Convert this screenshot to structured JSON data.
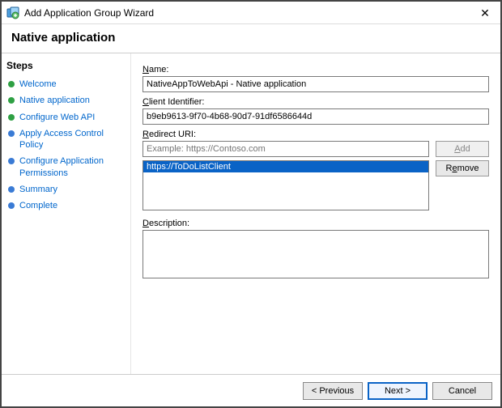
{
  "window": {
    "title": "Add Application Group Wizard",
    "close_label": "✕"
  },
  "heading": "Native application",
  "sidebar": {
    "title": "Steps",
    "items": [
      {
        "label": "Welcome",
        "state": "done"
      },
      {
        "label": "Native application",
        "state": "done"
      },
      {
        "label": "Configure Web API",
        "state": "done"
      },
      {
        "label": "Apply Access Control Policy",
        "state": "pending"
      },
      {
        "label": "Configure Application Permissions",
        "state": "pending"
      },
      {
        "label": "Summary",
        "state": "pending"
      },
      {
        "label": "Complete",
        "state": "pending"
      }
    ]
  },
  "form": {
    "name_label_pre": "",
    "name_label_u": "N",
    "name_label_post": "ame:",
    "name_value": "NativeAppToWebApi - Native application",
    "client_id_label_pre": "",
    "client_id_label_u": "C",
    "client_id_label_post": "lient Identifier:",
    "client_id_value": "b9eb9613-9f70-4b68-90d7-91df6586644d",
    "redirect_label_pre": "",
    "redirect_label_u": "R",
    "redirect_label_post": "edirect URI:",
    "redirect_placeholder": "Example: https://Contoso.com",
    "redirect_value": "",
    "add_btn_pre": "",
    "add_btn_u": "A",
    "add_btn_post": "dd",
    "remove_btn_pre": "R",
    "remove_btn_u": "e",
    "remove_btn_post": "move",
    "uri_list": [
      {
        "text": "https://ToDoListClient",
        "selected": true
      }
    ],
    "desc_label_pre": "",
    "desc_label_u": "D",
    "desc_label_post": "escription:",
    "desc_value": ""
  },
  "footer": {
    "previous": "< Previous",
    "next": "Next >",
    "cancel": "Cancel"
  }
}
